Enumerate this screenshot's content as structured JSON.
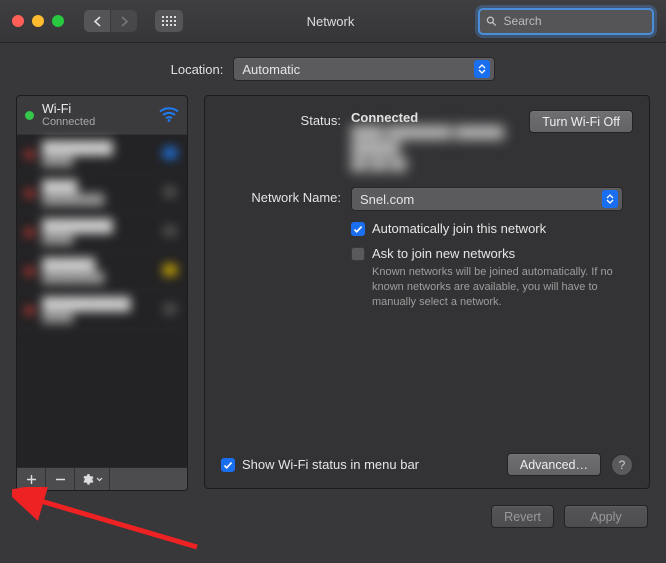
{
  "window": {
    "title": "Network"
  },
  "search": {
    "placeholder": "Search"
  },
  "location": {
    "label": "Location:",
    "value": "Automatic"
  },
  "sidebar": {
    "services": [
      {
        "name": "Wi-Fi",
        "sub": "Connected",
        "status": "green",
        "iconColor": "#1f7cf4"
      },
      {
        "name": "████████",
        "sub": "████",
        "status": "red",
        "iconColor": "#1f7cf4"
      },
      {
        "name": "████",
        "sub": "████████",
        "status": "red",
        "iconColor": "#555"
      },
      {
        "name": "████████",
        "sub": "████",
        "status": "red",
        "iconColor": "#555"
      },
      {
        "name": "██████",
        "sub": "████████",
        "status": "red",
        "iconColor": "#d8b400"
      },
      {
        "name": "██████████",
        "sub": "████",
        "status": "red",
        "iconColor": "#555"
      }
    ]
  },
  "main": {
    "statusLabel": "Status:",
    "statusValue": "Connected",
    "wifiToggle": "Turn Wi-Fi Off",
    "netNameLabel": "Network Name:",
    "netNameValue": "Snel.com",
    "autoJoin": "Automatically join this network",
    "askJoin": "Ask to join new networks",
    "askHint": "Known networks will be joined automatically. If no known networks are available, you will have to manually select a network.",
    "showStatus": "Show Wi-Fi status in menu bar",
    "advanced": "Advanced…"
  },
  "footer": {
    "revert": "Revert",
    "apply": "Apply"
  }
}
